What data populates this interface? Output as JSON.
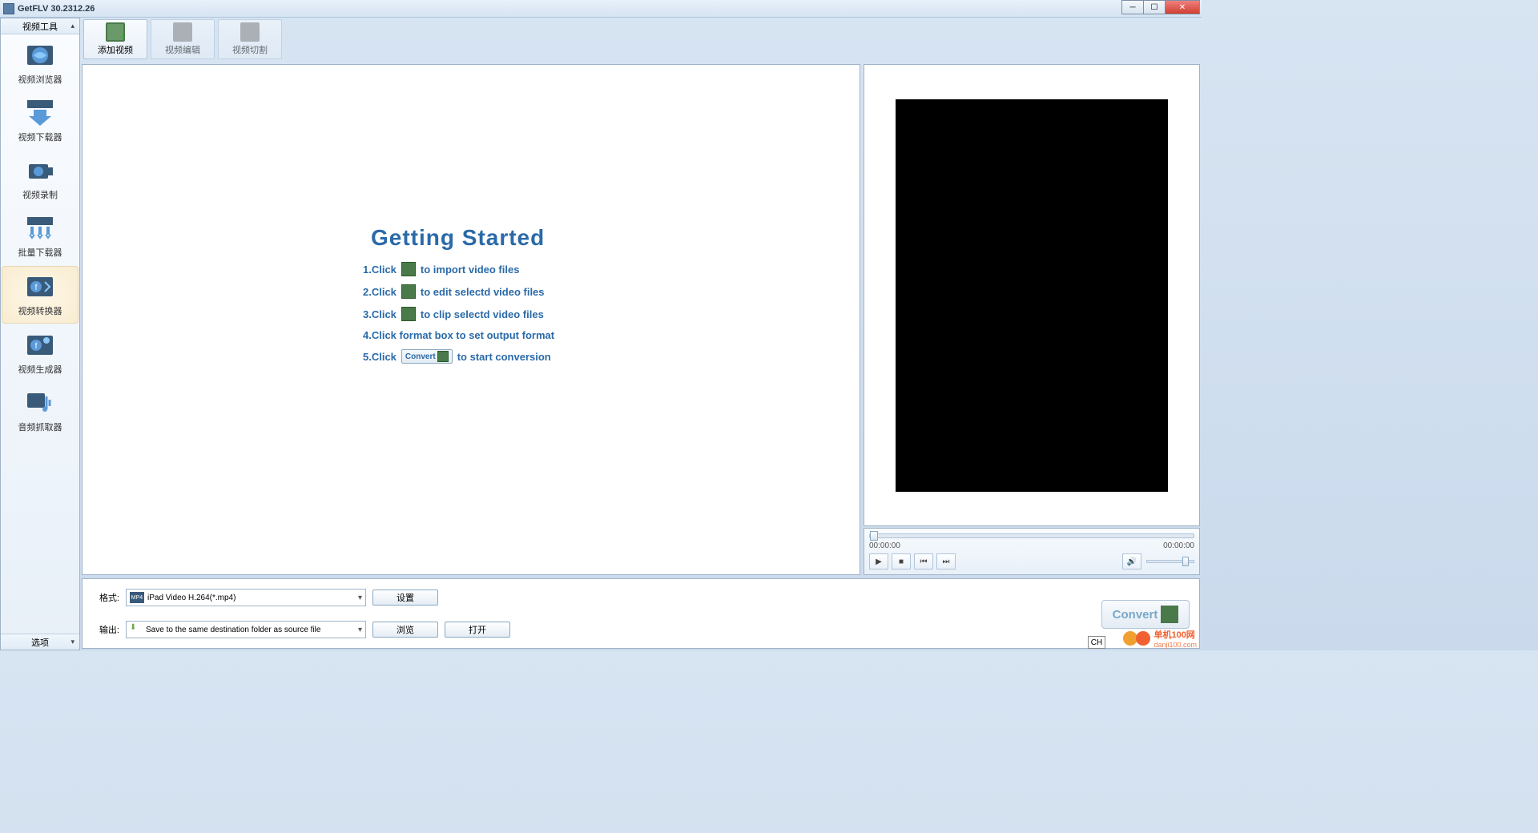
{
  "window": {
    "title": "GetFLV 30.2312.26"
  },
  "sidebar": {
    "header": "视频工具",
    "footer": "选项",
    "items": [
      {
        "label": "视频浏览器"
      },
      {
        "label": "视频下载器"
      },
      {
        "label": "视频录制"
      },
      {
        "label": "批量下载器"
      },
      {
        "label": "视频转换器"
      },
      {
        "label": "视频生成器"
      },
      {
        "label": "音频抓取器"
      }
    ]
  },
  "toolbar": {
    "add": "添加视频",
    "edit": "视频编辑",
    "clip": "视频切割"
  },
  "getting_started": {
    "title": "Getting Started",
    "s1a": "1.Click",
    "s1b": "to import video files",
    "s2a": "2.Click",
    "s2b": "to edit selectd video files",
    "s3a": "3.Click",
    "s3b": "to clip selectd video files",
    "s4": "4.Click format box to set output format",
    "s5a": "5.Click",
    "s5b": "to start conversion",
    "convert_small": "Convert"
  },
  "preview": {
    "t0": "00:00:00",
    "t1": "00:00:00"
  },
  "form": {
    "format_label": "格式:",
    "format_value": "iPad Video H.264(*.mp4)",
    "format_badge": "MP4",
    "output_label": "输出:",
    "output_value": "Save to the same destination folder as source file",
    "settings": "设置",
    "browse": "浏览",
    "open": "打开"
  },
  "convert": "Convert",
  "watermark": {
    "line1": "单机100网",
    "line2": "danji100.com"
  },
  "ime": "CH"
}
